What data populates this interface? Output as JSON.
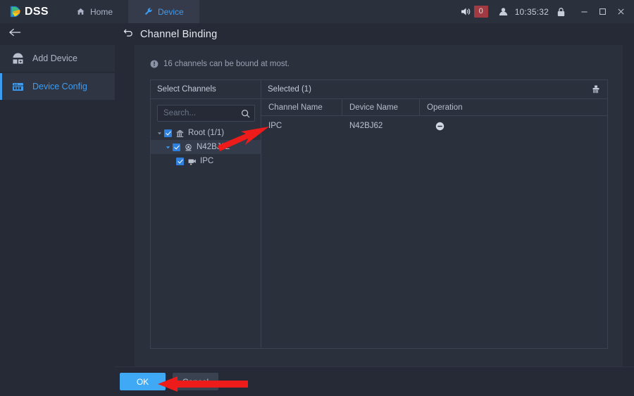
{
  "app": {
    "logo_text": "DSS",
    "accent": "#3e9cf0",
    "alert_color": "#a23a43"
  },
  "titlebar": {
    "tabs": [
      {
        "label": "Home",
        "icon": "home-icon",
        "active": false
      },
      {
        "label": "Device",
        "icon": "wrench-icon",
        "active": true
      }
    ],
    "volume_icon": "speaker-icon",
    "alarm_count": "0",
    "user_icon": "user-icon",
    "clock": "10:35:32",
    "lock_icon": "lock-icon",
    "minimize_icon": "minimize-icon",
    "maximize_icon": "maximize-icon",
    "close_icon": "close-icon"
  },
  "sidebar": {
    "back_icon": "back-arrow-icon",
    "items": [
      {
        "label": "Add Device",
        "icon": "add-device-icon",
        "active": false
      },
      {
        "label": "Device Config",
        "icon": "device-config-icon",
        "active": true
      }
    ]
  },
  "page": {
    "back_icon": "return-arrow-icon",
    "title": "Channel Binding",
    "notice": "16 channels can be bound at most.",
    "notice_icon": "info-icon"
  },
  "left_panel": {
    "header": "Select Channels",
    "search_placeholder": "Search...",
    "search_value": "",
    "search_icon": "search-icon",
    "tree": [
      {
        "label": "Root (1/1)",
        "icon": "org-icon",
        "level": 0,
        "checked": true,
        "expanded": true,
        "highlighted": false
      },
      {
        "label": "N42BJ62",
        "icon": "device-icon",
        "level": 1,
        "checked": true,
        "expanded": true,
        "highlighted": true
      },
      {
        "label": "IPC",
        "icon": "camera-icon",
        "level": 2,
        "checked": true,
        "expanded": false,
        "highlighted": false
      }
    ]
  },
  "right_panel": {
    "header": "Selected (1)",
    "clear_icon": "clear-all-icon",
    "columns": [
      "Channel Name",
      "Device Name",
      "Operation"
    ],
    "rows": [
      {
        "channel_name": "IPC",
        "device_name": "N42BJ62",
        "operation_icon": "remove-icon"
      }
    ]
  },
  "footer": {
    "ok_label": "OK",
    "cancel_label": "Cancel"
  }
}
